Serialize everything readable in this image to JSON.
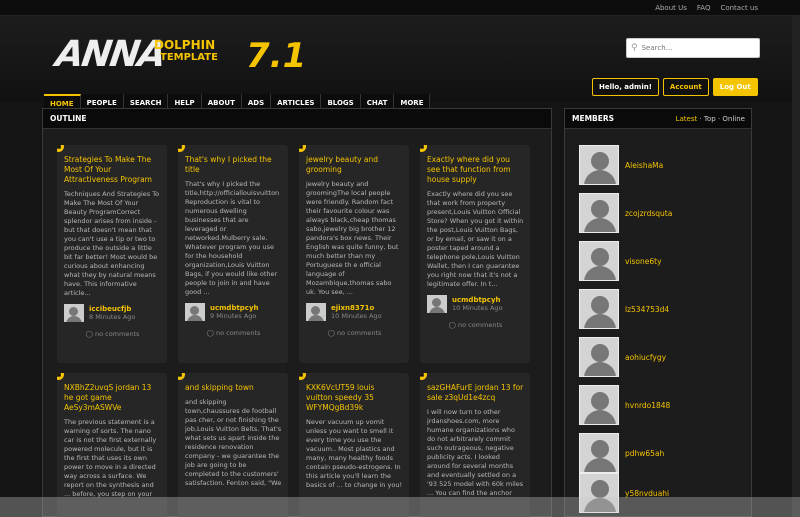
{
  "toplinks": [
    "About Us",
    "FAQ",
    "Contact us"
  ],
  "logo": {
    "main": "ANNA",
    "line1": "DOLPHIN",
    "line2": "TEMPLATE",
    "version": "7.1"
  },
  "search": {
    "placeholder": "Search..."
  },
  "user": {
    "greeting": "Hello, admin!",
    "account": "Account",
    "logout": "Log Out"
  },
  "nav": [
    "HOME",
    "PEOPLE",
    "SEARCH",
    "HELP",
    "ABOUT",
    "ADS",
    "ARTICLES",
    "BLOGS",
    "CHAT",
    "MORE"
  ],
  "outline": {
    "title": "OUTLINE"
  },
  "cards": [
    {
      "title": "Strategies To Make The Most Of Your Attractiveness Program",
      "text": "Techniques And Strategies To Make The Most Of Your Beauty ProgramCorrect splendor arises from inside - but that doesn't mean that you can't use a tip or two to produce the outside a little bit far better! Most would be curious about enhancing what they by natural means have. This informative article...",
      "author": "iccibeucfjb",
      "time": "8 Minutes Ago",
      "comments": "no comments"
    },
    {
      "title": "That's why I picked the title",
      "text": "That's why I picked the title,http://officiallouisvuitton Reproduction is vital to numerous dwelling businesses that are leveraged or networked.Mulberry sale. Whatever program you use for the household organization,Louis Vuitton Bags, if you would like other people to join in and have good ...",
      "author": "ucmdbtpcyh",
      "time": "9 Minutes Ago",
      "comments": "no comments"
    },
    {
      "title": "jewelry beauty and grooming",
      "text": "jewelry beauty and groomingThe local people were friendly. Random fact their favourite colour was always black,cheap thomas sabo,jewelry big brother 12 pandora's box news. Their English was quite funny, but much better than my Portuguese th e official language of Mozambique,thomas sabo uk. You see, ...",
      "author": "ejixn8371o",
      "time": "10 Minutes Ago",
      "comments": "no comments"
    },
    {
      "title": "Exactly where did you see that function from house supply",
      "text": "Exactly where did you see that work from property present,Louis Vuitton Official Store? When you got it within the post,Louis Vuitton Bags, or by email, or saw it on a poster taped around a telephone pole,Louis Vuitton Wallet, then I can guarantee you right now that it's not a legitimate offer. In t...",
      "author": "ucmdbtpcyh",
      "time": "10 Minutes Ago",
      "comments": "no comments"
    },
    {
      "title": "NXBhZ2uvqS jordan 13 he got game AeSy3mASWVe",
      "text": "The previous statement is a warning of sorts. The nano car is not the first externally powered molecule, but it is the first that uses its own power to move in a directed way across a surface. We report on the synthesis and ... before, you step on your"
    },
    {
      "title": "and skipping town",
      "text": "and skipping town,chaussures de football pas cher, or not finishing the job,Louis Vuitton Belts. That's what sets us apart inside the residence renovation company - we guarantee the job are going to be completed to the customers' satisfaction. Fenton said, \"We"
    },
    {
      "title": "KXK6VcUT59 louis vuitton speedy 35 WFYMQgBd39k",
      "text": "Never vacuum up vomit unless you want to smell it every time you use the vacuum.. Most plastics and many, many healthy foods contain pseudo-estrogens. In this article you'll learn the basics of ... to change in you!"
    },
    {
      "title": "sazGHAFurE jordan 13 for sale z3qUd1e4zcq",
      "text": "I will now turn to other jrdanshoes.com, more humane organizations who do not arbitrarely commit such outrageous, negative publicity acts. I looked around for several months and eventually settled on a '93 525 model with 60k miles ... You can find the anchor"
    }
  ],
  "members": {
    "title": "MEMBERS",
    "tabs": {
      "latest": "Latest",
      "sep1": " · ",
      "top": "Top",
      "sep2": " · ",
      "online": "Online"
    },
    "list": [
      "AleishaMa",
      "zcojzrdsquta",
      "visone6ty",
      "lz534753d4",
      "aohiucfygy",
      "hvnrdo1848",
      "pdhw65ah",
      "y58nvduahi"
    ]
  }
}
